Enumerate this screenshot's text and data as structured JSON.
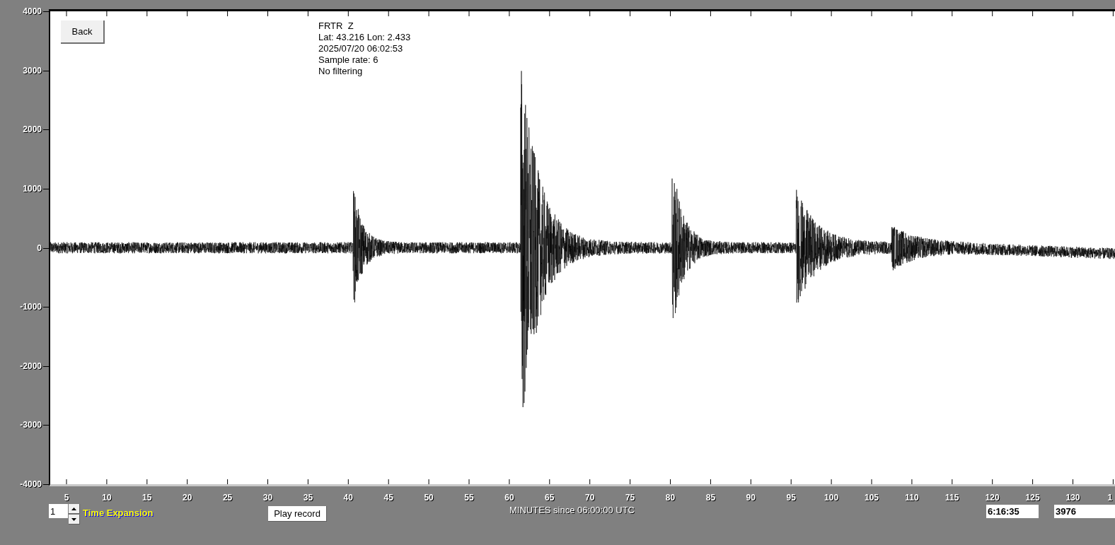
{
  "back_button": "Back",
  "station_info": [
    "FRTR  Z",
    "Lat: 43.216 Lon: 2.433",
    "2025/07/20 06:02:53",
    "Sample rate: 6",
    "No filtering"
  ],
  "y_axis_labels": [
    "4000",
    "3000",
    "2000",
    "1000",
    "0",
    "-1000",
    "-2000",
    "-3000",
    "-4000"
  ],
  "x_axis_labels": [
    "5",
    "10",
    "15",
    "20",
    "25",
    "30",
    "35",
    "40",
    "45",
    "50",
    "55",
    "60",
    "65",
    "70",
    "75",
    "80",
    "85",
    "90",
    "95",
    "100",
    "105",
    "110",
    "115",
    "120",
    "125",
    "130",
    "1"
  ],
  "x_axis_title": "MINUTES since 06:00:00 UTC",
  "time_expansion": {
    "value": "1",
    "label": "Time Expansion"
  },
  "play_button": "Play record",
  "time_field": "6:16:35",
  "count_field": "3976"
}
